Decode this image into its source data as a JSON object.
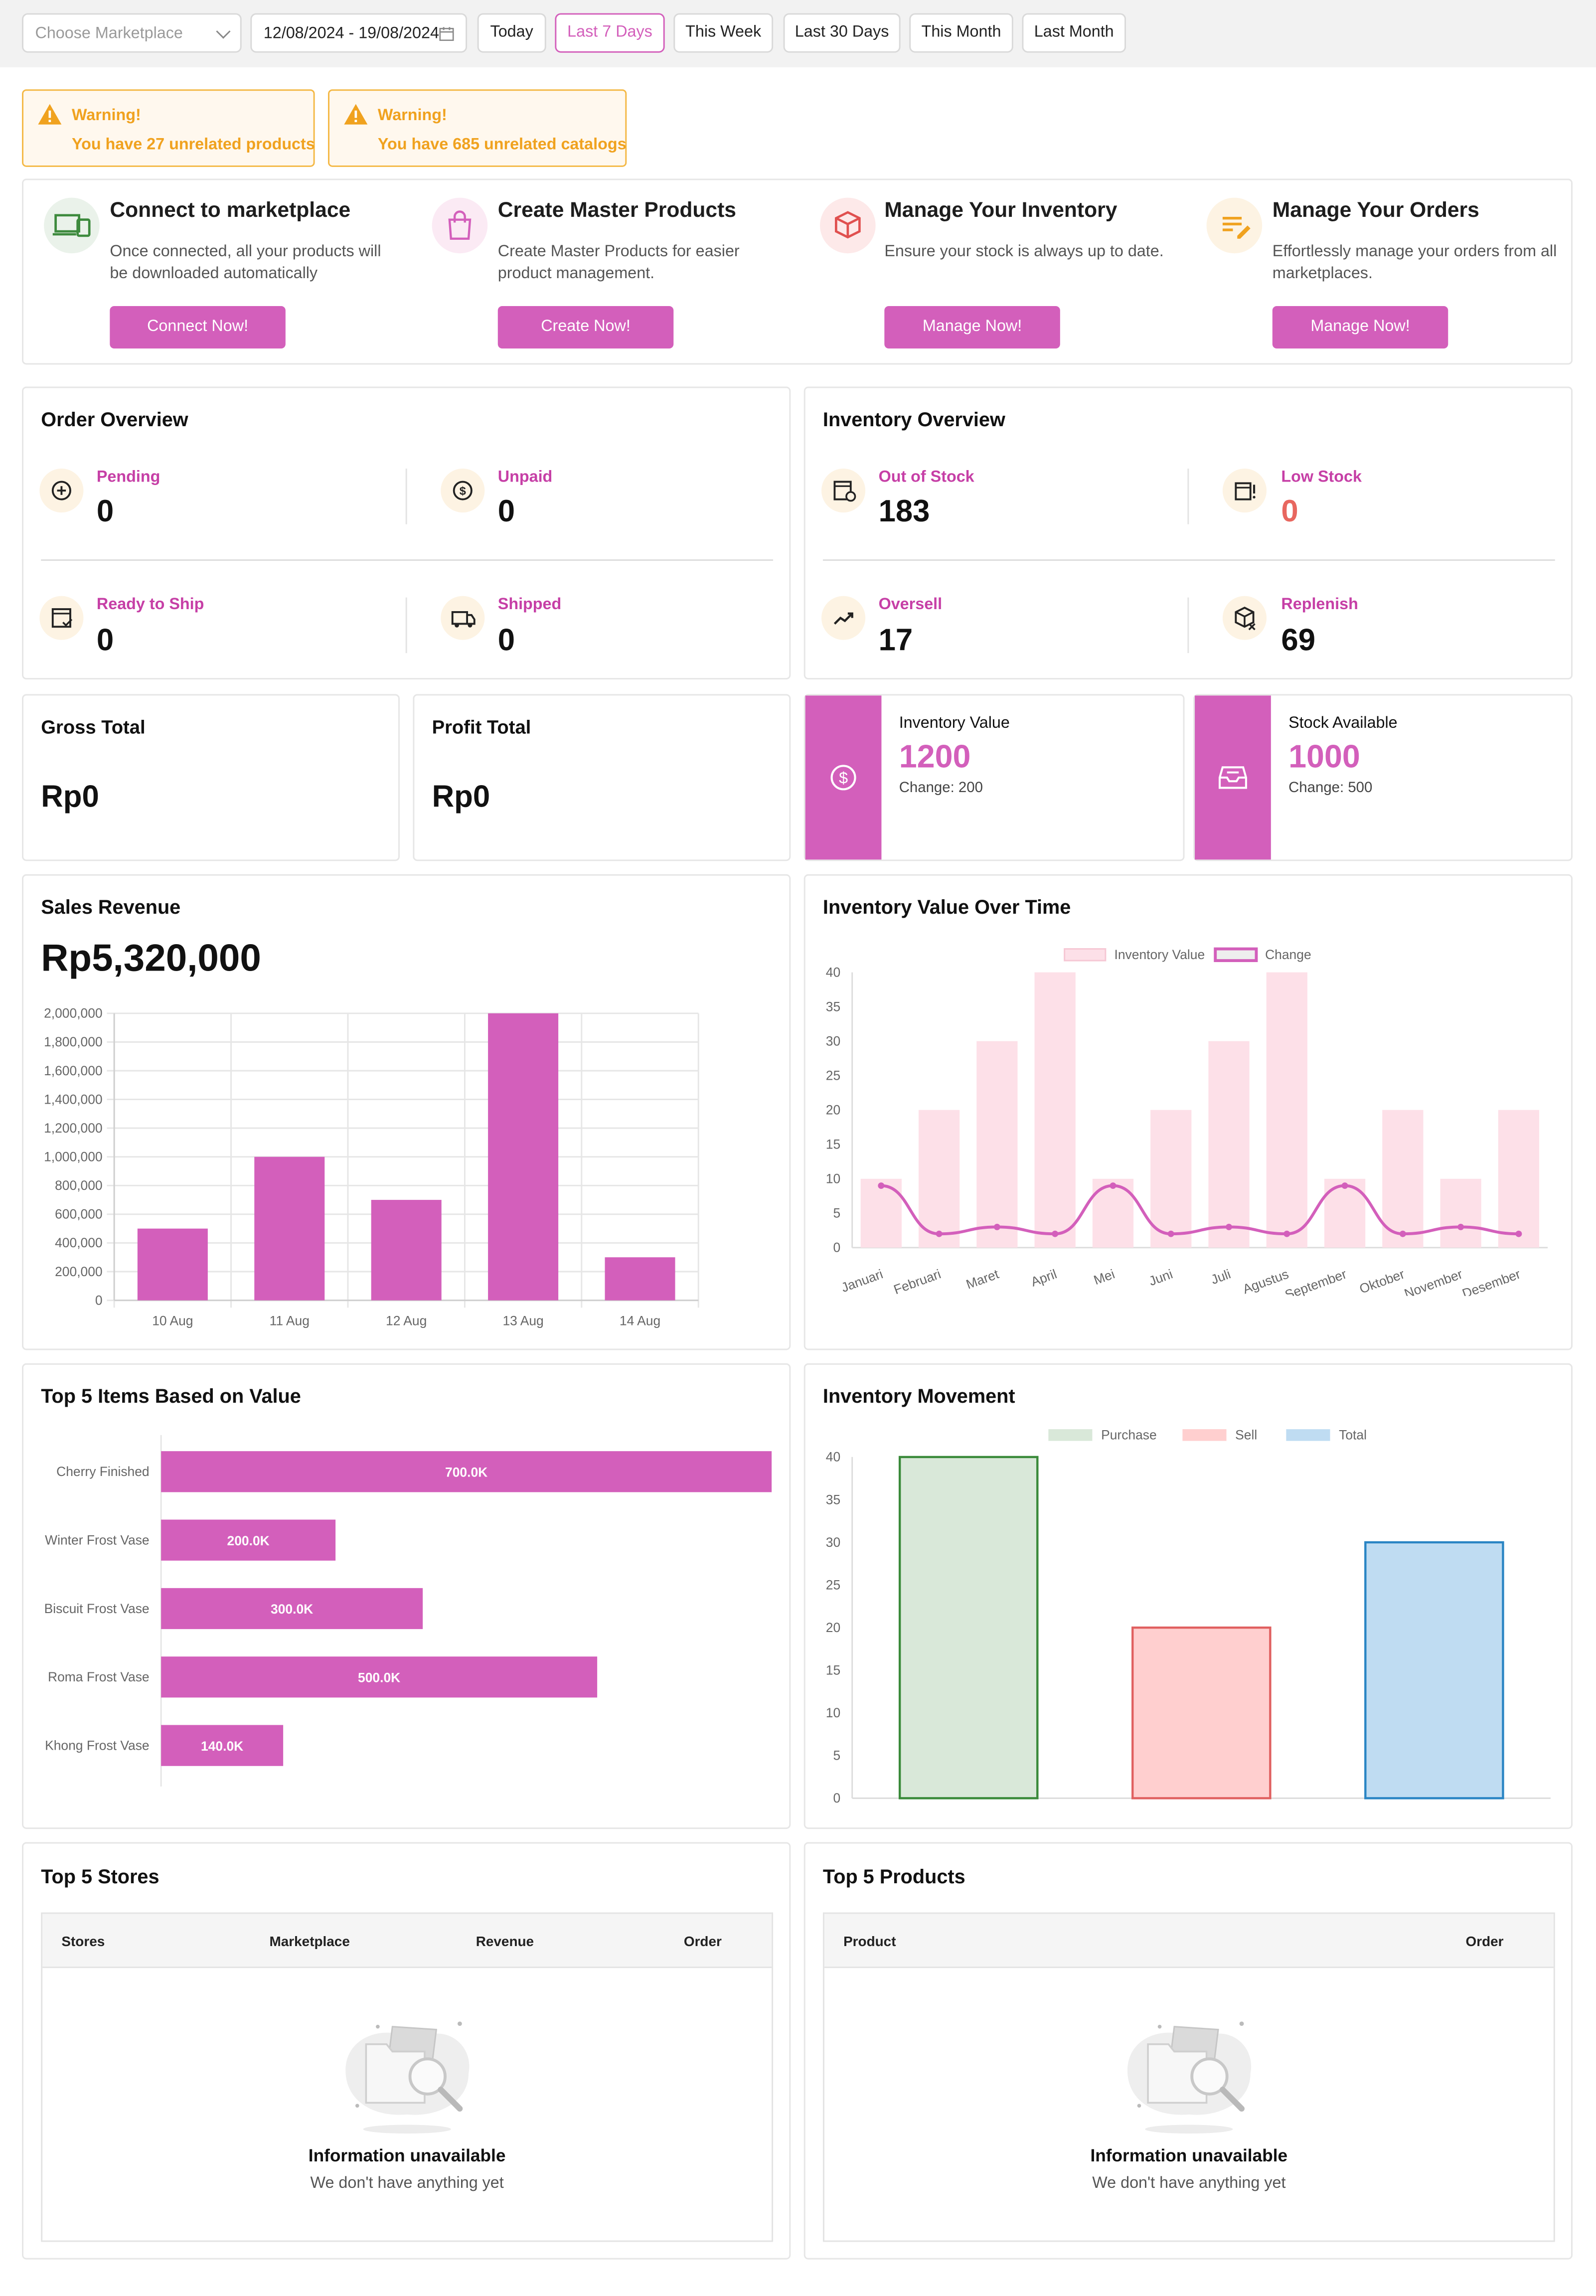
{
  "filters": {
    "marketplace_placeholder": "Choose Marketplace",
    "date_range": "12/08/2024 - 19/08/2024",
    "ranges": [
      "Today",
      "Last 7 Days",
      "This Week",
      "Last 30 Days",
      "This Month",
      "Last Month"
    ],
    "active_range": "Last 7 Days"
  },
  "warnings": [
    {
      "title": "Warning!",
      "message": "You have 27 unrelated products"
    },
    {
      "title": "Warning!",
      "message": "You have 685 unrelated catalogs"
    }
  ],
  "quick_start": [
    {
      "icon": "devices-icon",
      "title": "Connect to marketplace",
      "desc": "Once connected, all your products will be downloaded automatically",
      "button": "Connect Now!"
    },
    {
      "icon": "shopping-bag-icon",
      "title": "Create Master Products",
      "desc": "Create Master Products for easier product management.",
      "button": "Create Now!"
    },
    {
      "icon": "box-icon",
      "title": "Manage Your Inventory",
      "desc": "Ensure your stock is always up to date.",
      "button": "Manage Now!"
    },
    {
      "icon": "edit-list-icon",
      "title": "Manage Your Orders",
      "desc": "Effortlessly manage your orders from all marketplaces.",
      "button": "Manage Now!"
    }
  ],
  "order_overview": {
    "title": "Order Overview",
    "items": [
      {
        "icon": "plus-circle-icon",
        "label": "Pending",
        "value": "0"
      },
      {
        "icon": "dollar-circle-icon",
        "label": "Unpaid",
        "value": "0"
      },
      {
        "icon": "ready-ship-icon",
        "label": "Ready to Ship",
        "value": "0"
      },
      {
        "icon": "truck-icon",
        "label": "Shipped",
        "value": "0"
      }
    ]
  },
  "inventory_overview": {
    "title": "Inventory Overview",
    "items": [
      {
        "icon": "out-of-stock-icon",
        "label": "Out of Stock",
        "value": "183"
      },
      {
        "icon": "low-stock-icon",
        "label": "Low Stock",
        "value": "0"
      },
      {
        "icon": "trend-up-icon",
        "label": "Oversell",
        "value": "17"
      },
      {
        "icon": "replenish-icon",
        "label": "Replenish",
        "value": "69"
      }
    ]
  },
  "gross_total": {
    "label": "Gross Total",
    "value": "Rp0"
  },
  "profit_total": {
    "label": "Profit Total",
    "value": "Rp0"
  },
  "inventory_value_card": {
    "label": "Inventory Value",
    "value": "1200",
    "change": "Change: 200"
  },
  "stock_available_card": {
    "label": "Stock Available",
    "value": "1000",
    "change": "Change: 500"
  },
  "sales_revenue": {
    "title": "Sales Revenue",
    "total": "Rp5,320,000"
  },
  "inventory_value_over_time": {
    "title": "Inventory Value Over Time"
  },
  "top_items": {
    "title": "Top 5 Items Based on Value"
  },
  "inventory_movement": {
    "title": "Inventory Movement"
  },
  "top_stores": {
    "title": "Top 5 Stores",
    "columns": [
      "Stores",
      "Marketplace",
      "Revenue",
      "Order"
    ],
    "empty_title": "Information unavailable",
    "empty_sub": "We don't have anything yet"
  },
  "top_products": {
    "title": "Top 5 Products",
    "columns": [
      "Product",
      "Order"
    ],
    "empty_title": "Information unavailable",
    "empty_sub": "We don't have anything yet"
  },
  "colors": {
    "accent": "#d35fbb",
    "warning": "#f0a21f",
    "low_stock": "#e8675f"
  },
  "chart_data": [
    {
      "type": "bar",
      "title": "Sales Revenue",
      "categories": [
        "10 Aug",
        "11 Aug",
        "12 Aug",
        "13 Aug",
        "14 Aug"
      ],
      "values": [
        500000,
        1000000,
        700000,
        2000000,
        300000
      ],
      "ylim": [
        0,
        2000000
      ],
      "yticks": [
        "0",
        "200,000",
        "400,000",
        "600,000",
        "800,000",
        "1,000,000",
        "1,200,000",
        "1,400,000",
        "1,600,000",
        "1,800,000",
        "2,000,000"
      ],
      "grid": true
    },
    {
      "type": "bar",
      "title": "Inventory Value Over Time",
      "categories": [
        "Januari",
        "Februari",
        "Maret",
        "April",
        "Mei",
        "Juni",
        "Juli",
        "Agustus",
        "September",
        "Oktober",
        "November",
        "Desember"
      ],
      "series": [
        {
          "name": "Inventory Value",
          "type": "bar",
          "color": "#fde0e8",
          "values": [
            10,
            20,
            30,
            40,
            10,
            20,
            30,
            40,
            10,
            20,
            10,
            20
          ]
        },
        {
          "name": "Change",
          "type": "line",
          "color": "#d35fbb",
          "values": [
            9,
            2,
            3,
            2,
            9,
            2,
            3,
            2,
            9,
            2,
            3,
            2
          ]
        }
      ],
      "ylim": [
        0,
        40
      ],
      "yticks": [
        "0",
        "5",
        "10",
        "15",
        "20",
        "25",
        "30",
        "35",
        "40"
      ],
      "legend": "top"
    },
    {
      "type": "bar",
      "orientation": "horizontal",
      "title": "Top 5 Items Based on Value",
      "categories": [
        "Cherry Finished",
        "Winter Frost Vase",
        "Biscuit Frost Vase",
        "Roma Frost Vase",
        "Khong Frost Vase"
      ],
      "values": [
        700000,
        200000,
        300000,
        500000,
        140000
      ],
      "value_labels": [
        "700.0K",
        "200.0K",
        "300.0K",
        "500.0K",
        "140.0K"
      ],
      "xlim": [
        0,
        700000
      ]
    },
    {
      "type": "bar",
      "title": "Inventory Movement",
      "categories": [
        "Purchase",
        "Sell",
        "Total"
      ],
      "series": [
        {
          "name": "Purchase",
          "value": 40,
          "fill": "#d9e8d9",
          "stroke": "#3a8a3a"
        },
        {
          "name": "Sell",
          "value": 20,
          "fill": "#ffcfcf",
          "stroke": "#e06060"
        },
        {
          "name": "Total",
          "value": 30,
          "fill": "#bfdcf2",
          "stroke": "#2a85c4"
        }
      ],
      "ylim": [
        0,
        40
      ],
      "yticks": [
        "0",
        "5",
        "10",
        "15",
        "20",
        "25",
        "30",
        "35",
        "40"
      ],
      "legend": "top"
    }
  ]
}
